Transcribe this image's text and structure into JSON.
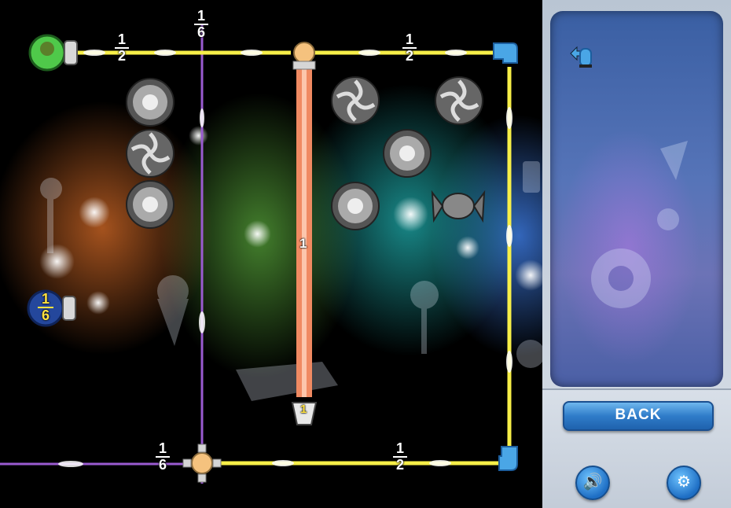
{
  "beams": {
    "top_left": {
      "num": "1",
      "den": "2"
    },
    "top_right": {
      "num": "1",
      "den": "2"
    },
    "vertical_left": {
      "num": "1",
      "den": "6"
    },
    "vertical_middle": "1",
    "bottom_left": {
      "num": "1",
      "den": "6"
    },
    "bottom_right": {
      "num": "1",
      "den": "2"
    }
  },
  "sources": {
    "left_source": {
      "num": "1",
      "den": "6"
    },
    "middle_target": "1"
  },
  "panel": {
    "back_label": "BACK",
    "sound_icon": "speaker-icon",
    "settings_icon": "gear-icon"
  },
  "colors": {
    "yellow_beam": "#f7ef48",
    "orange_beam": "#f08a62",
    "purple_beam": "#9a5bd0",
    "accent_blue": "#2f7cc9"
  }
}
